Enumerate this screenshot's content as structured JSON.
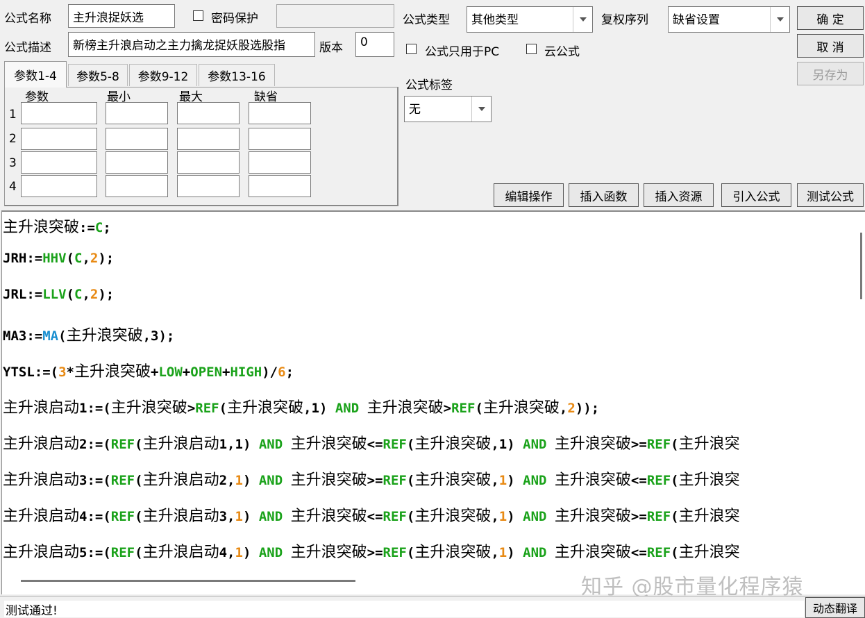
{
  "header": {
    "formula_name_label": "公式名称",
    "formula_name_value": "主升浪捉妖选",
    "password_label": "密码保护",
    "password_value": "",
    "formula_desc_label": "公式描述",
    "formula_desc_value": "新榜主升浪启动之主力擒龙捉妖股选股指",
    "version_label": "版本",
    "version_value": "0",
    "formula_type_label": "公式类型",
    "formula_type_value": "其他类型",
    "restore_label": "复权序列",
    "restore_value": "缺省设置",
    "pc_only_label": "公式只用于PC",
    "cloud_label": "云公式",
    "tag_label": "公式标签",
    "tag_value": "无"
  },
  "buttons": {
    "confirm": "确 定",
    "cancel": "取 消",
    "save_as": "另存为",
    "edit_ops": "编辑操作",
    "insert_func": "插入函数",
    "insert_res": "插入资源",
    "import_formula": "引入公式",
    "test_formula": "测试公式"
  },
  "params": {
    "tabs": [
      "参数1-4",
      "参数5-8",
      "参数9-12",
      "参数13-16"
    ],
    "columns": [
      "参数",
      "最小",
      "最大",
      "缺省"
    ],
    "rows": [
      "1",
      "2",
      "3",
      "4"
    ]
  },
  "code": [
    "主升浪突破:=C;",
    "JRH:=HHV(C,2);",
    "JRL:=LLV(C,2);",
    "MA3:=MA(主升浪突破,3);",
    "YTSL:=(3*主升浪突破+LOW+OPEN+HIGH)/6;",
    "主升浪启动1:=(主升浪突破>REF(主升浪突破,1) AND 主升浪突破>REF(主升浪突破,2));",
    "主升浪启动2:=(REF(主升浪启动1,1) AND 主升浪突破<=REF(主升浪突破,1) AND 主升浪突破>=REF(主升浪突",
    "主升浪启动3:=(REF(主升浪启动2,1) AND 主升浪突破>=REF(主升浪突破,1) AND 主升浪突破<=REF(主升浪突",
    "主升浪启动4:=(REF(主升浪启动3,1) AND 主升浪突破<=REF(主升浪突破,1) AND 主升浪突破>=REF(主升浪突",
    "主升浪启动5:=(REF(主升浪启动4,1) AND 主升浪突破>=REF(主升浪突破,1) AND 主升浪突破<=REF(主升浪突"
  ],
  "status": {
    "message": "测试通过!",
    "dynamic_translate": "动态翻译"
  },
  "watermark": "知乎 @股市量化程序猿",
  "colors": {
    "keyword": "#1aa21a",
    "number": "#e88a14",
    "function_ma": "#1a8fd0"
  }
}
